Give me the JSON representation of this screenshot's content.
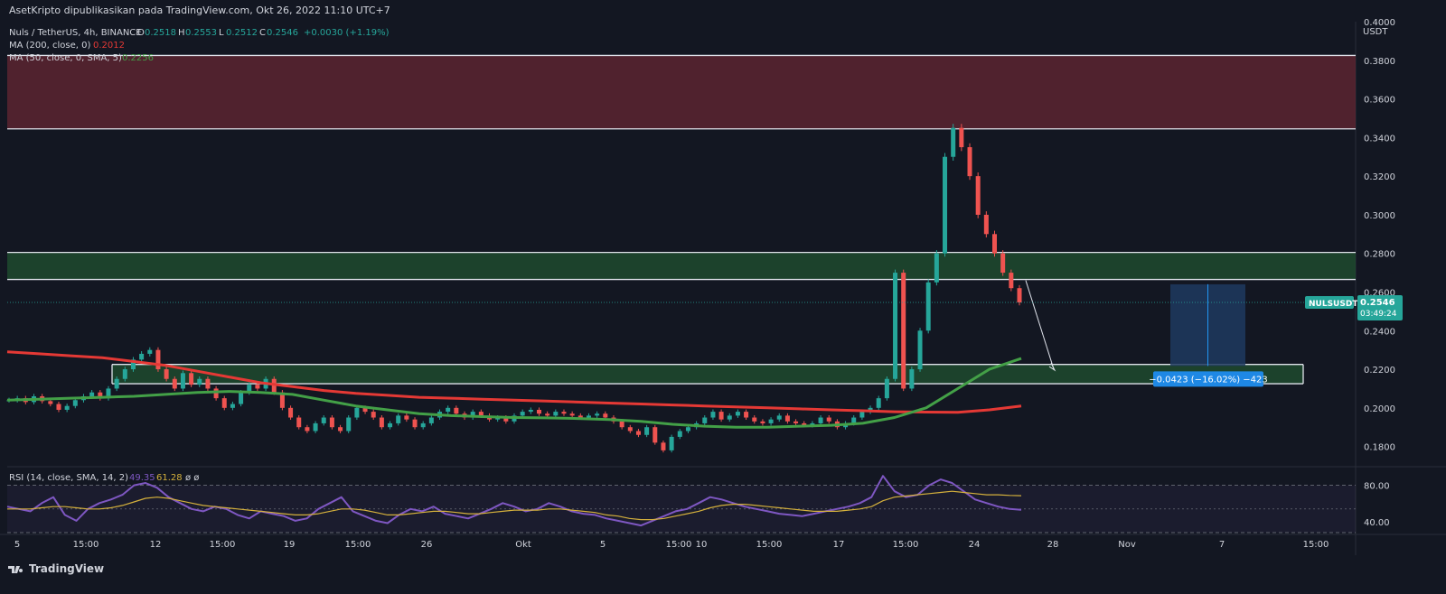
{
  "header": {
    "publisher": "AsetKripto dipublikasikan pada TradingView.com, Okt 26, 2022 11:10 UTC+7"
  },
  "legend": {
    "symbol": "Nuls / TetherUS, 4h, BINANCE",
    "ohlc": [
      {
        "k": "O",
        "v": "0.2518"
      },
      {
        "k": "H",
        "v": "0.2553"
      },
      {
        "k": "L",
        "v": "0.2512"
      },
      {
        "k": "C",
        "v": "0.2546"
      }
    ],
    "change": "+0.0030 (+1.19%)",
    "ma200": {
      "label": "MA (200, close, 0)",
      "value": "0.2012"
    },
    "ma50": {
      "label": "MA (50, close, 0, SMA, 5)",
      "value": "0.2256"
    },
    "rsi": {
      "label": "RSI (14, close, SMA, 14, 2)",
      "value": "49.35",
      "sma": "61.28",
      "extra": "ø ø"
    }
  },
  "price_tag": {
    "symbol": "NULSUSDT",
    "price": "0.2546",
    "countdown": "03:49:24"
  },
  "measure_label": "−0.0423 (−16.02%) −423",
  "footer": {
    "brand": "TradingView"
  },
  "colors": {
    "background": "#131722",
    "up": "#26a69a",
    "down": "#ef5350",
    "ma200": "#e53935",
    "ma50": "#43a047",
    "rsi": "#7e57c2",
    "rsi_sma": "#d4b03c",
    "supply_zone": "#5c2430",
    "demand_zone": "#1f4a2e",
    "measure_box": "#1e3a5f",
    "measure_label_bg": "#1e88e5"
  },
  "chart_data": {
    "type": "candlestick",
    "title": "Nuls / TetherUS, 4h, BINANCE",
    "y_axis_label": "USDT",
    "y_ticks": [
      "0.4000",
      "0.3800",
      "0.3600",
      "0.3400",
      "0.3200",
      "0.3000",
      "0.2800",
      "0.2600",
      "0.2400",
      "0.2200",
      "0.2000",
      "0.1800"
    ],
    "ylim": [
      0.17,
      0.4
    ],
    "x_ticks": [
      "5",
      "15:00",
      "12",
      "15:00",
      "19",
      "15:00",
      "26",
      "Okt",
      "5",
      "15:00",
      "10",
      "15:00",
      "17",
      "15:00",
      "24",
      "28",
      "Nov",
      "7",
      "15:00"
    ],
    "rsi_ticks": [
      "80.00",
      "40.00"
    ],
    "rsi_range": [
      30,
      85
    ],
    "zones": [
      {
        "name": "resistance",
        "y_top": 0.3825,
        "y_bottom": 0.3445
      },
      {
        "name": "mid-zone",
        "y_top": 0.2805,
        "y_bottom": 0.2665
      },
      {
        "name": "support",
        "y_top": 0.2225,
        "y_bottom": 0.2125
      }
    ],
    "current_price": 0.2546,
    "series_close": [
      0.204,
      0.205,
      0.203,
      0.206,
      0.2035,
      0.202,
      0.199,
      0.201,
      0.204,
      0.206,
      0.208,
      0.205,
      0.21,
      0.215,
      0.22,
      0.225,
      0.228,
      0.23,
      0.22,
      0.215,
      0.21,
      0.218,
      0.212,
      0.215,
      0.21,
      0.205,
      0.2,
      0.202,
      0.208,
      0.212,
      0.21,
      0.215,
      0.208,
      0.2,
      0.195,
      0.19,
      0.188,
      0.192,
      0.195,
      0.19,
      0.188,
      0.195,
      0.2,
      0.198,
      0.195,
      0.19,
      0.192,
      0.196,
      0.194,
      0.19,
      0.192,
      0.195,
      0.198,
      0.2,
      0.197,
      0.195,
      0.198,
      0.196,
      0.194,
      0.195,
      0.193,
      0.196,
      0.198,
      0.199,
      0.197,
      0.196,
      0.198,
      0.197,
      0.196,
      0.195,
      0.196,
      0.197,
      0.195,
      0.193,
      0.19,
      0.188,
      0.186,
      0.19,
      0.182,
      0.178,
      0.185,
      0.188,
      0.19,
      0.192,
      0.195,
      0.198,
      0.194,
      0.196,
      0.198,
      0.195,
      0.193,
      0.192,
      0.194,
      0.196,
      0.193,
      0.192,
      0.191,
      0.192,
      0.195,
      0.193,
      0.19,
      0.192,
      0.195,
      0.198,
      0.2,
      0.205,
      0.215,
      0.27,
      0.21,
      0.22,
      0.24,
      0.265,
      0.28,
      0.33,
      0.345,
      0.335,
      0.32,
      0.3,
      0.29,
      0.28,
      0.27,
      0.262,
      0.2546
    ],
    "ma200": [
      0.229,
      0.228,
      0.227,
      0.226,
      0.224,
      0.222,
      0.219,
      0.216,
      0.213,
      0.211,
      0.209,
      0.2075,
      0.2065,
      0.2055,
      0.205,
      0.2045,
      0.204,
      0.2035,
      0.203,
      0.2025,
      0.202,
      0.2015,
      0.201,
      0.2005,
      0.2,
      0.1995,
      0.199,
      0.1985,
      0.198,
      0.1978,
      0.1977,
      0.199,
      0.201
    ],
    "ma50": [
      0.204,
      0.2045,
      0.205,
      0.2055,
      0.206,
      0.207,
      0.208,
      0.2085,
      0.208,
      0.207,
      0.204,
      0.201,
      0.199,
      0.197,
      0.196,
      0.1955,
      0.195,
      0.1948,
      0.1945,
      0.194,
      0.193,
      0.1915,
      0.1905,
      0.19,
      0.19,
      0.1905,
      0.191,
      0.192,
      0.195,
      0.2,
      0.21,
      0.22,
      0.2256
    ],
    "rsi": [
      52,
      50,
      48,
      55,
      60,
      45,
      40,
      50,
      55,
      58,
      62,
      70,
      72,
      68,
      60,
      55,
      50,
      48,
      52,
      50,
      45,
      42,
      48,
      46,
      44,
      40,
      42,
      50,
      55,
      60,
      48,
      44,
      40,
      38,
      45,
      50,
      48,
      52,
      46,
      44,
      42,
      46,
      50,
      55,
      52,
      48,
      50,
      55,
      52,
      48,
      46,
      45,
      42,
      40,
      38,
      36,
      40,
      44,
      48,
      50,
      55,
      60,
      58,
      55,
      52,
      50,
      48,
      46,
      45,
      44,
      46,
      48,
      50,
      52,
      55,
      60,
      78,
      65,
      60,
      62,
      70,
      75,
      72,
      65,
      58,
      55,
      52,
      50,
      49.35
    ],
    "rsi_sma": [
      50,
      50,
      50,
      51,
      52,
      52,
      51,
      50,
      50,
      51,
      53,
      56,
      59,
      60,
      59,
      57,
      55,
      53,
      52,
      51,
      50,
      49,
      48,
      47,
      46,
      45,
      45,
      46,
      48,
      50,
      50,
      49,
      47,
      45,
      45,
      46,
      47,
      48,
      48,
      47,
      46,
      46,
      47,
      48,
      49,
      49,
      49,
      50,
      50,
      49,
      48,
      47,
      45,
      44,
      42,
      41,
      41,
      42,
      44,
      46,
      48,
      51,
      53,
      54,
      54,
      53,
      52,
      51,
      50,
      49,
      48,
      48,
      48,
      49,
      50,
      52,
      57,
      60,
      61,
      62,
      63,
      64,
      65,
      64,
      63,
      62,
      62,
      61.5,
      61.28
    ]
  }
}
